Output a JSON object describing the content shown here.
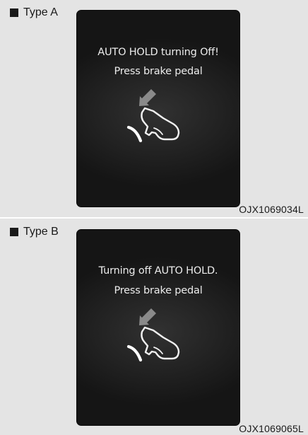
{
  "figures": [
    {
      "label": "Type A",
      "message_line1": "AUTO HOLD turning Off!",
      "message_line2": "Press brake pedal",
      "icon": "brake-pedal-press-icon",
      "code": "OJX1069034L"
    },
    {
      "label": "Type B",
      "message_line1": "Turning off AUTO HOLD.",
      "message_line2": "Press brake pedal",
      "icon": "brake-pedal-press-icon",
      "code": "OJX1069065L"
    }
  ],
  "colors": {
    "background": "#e4e4e4",
    "screen": "#1c1c1c",
    "screen_text": "#ececec",
    "icon_gray": "#8a8a8a"
  }
}
